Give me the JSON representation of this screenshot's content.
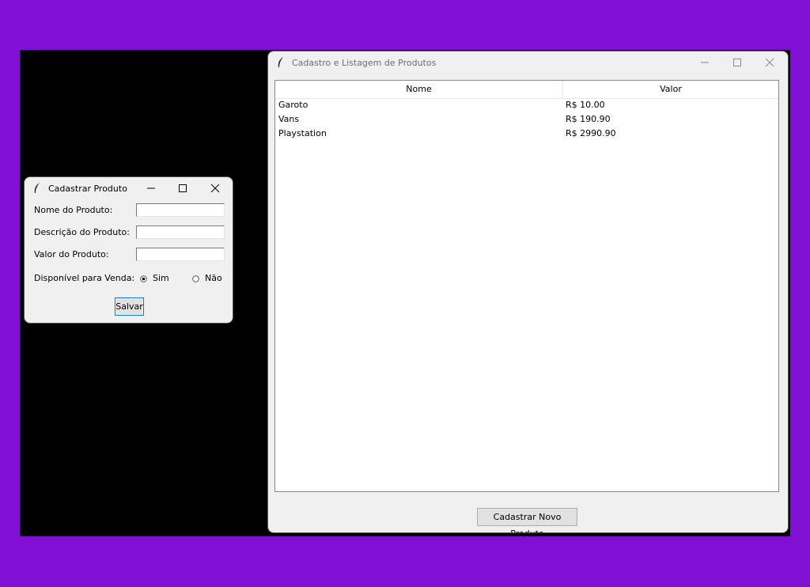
{
  "main_window": {
    "title": "Cadastro e Listagem de Produtos",
    "columns": [
      "Nome",
      "Valor"
    ],
    "rows": [
      {
        "nome": "Garoto",
        "valor": "R$ 10.00"
      },
      {
        "nome": "Vans",
        "valor": "R$ 190.90"
      },
      {
        "nome": "Playstation",
        "valor": "R$ 2990.90"
      }
    ],
    "new_product_button": "Cadastrar Novo Produto"
  },
  "dialog": {
    "title": "Cadastrar Produto",
    "fields": [
      {
        "label": "Nome do Produto:",
        "value": ""
      },
      {
        "label": "Descrição do Produto:",
        "value": ""
      },
      {
        "label": "Valor do Produto:",
        "value": ""
      }
    ],
    "available_label": "Disponível para Venda:",
    "options": [
      {
        "label": "Sim",
        "selected": true
      },
      {
        "label": "Não",
        "selected": false
      }
    ],
    "save_button": "Salvar"
  },
  "icons": {
    "app_icon": "feather-icon",
    "minimize": "minimize-icon",
    "maximize": "maximize-icon",
    "close": "close-icon"
  },
  "colors": {
    "wallpaper": "#8210d4",
    "desktop": "#000000",
    "window_bg": "#f0f0f0",
    "focus_border": "#0078d7"
  }
}
